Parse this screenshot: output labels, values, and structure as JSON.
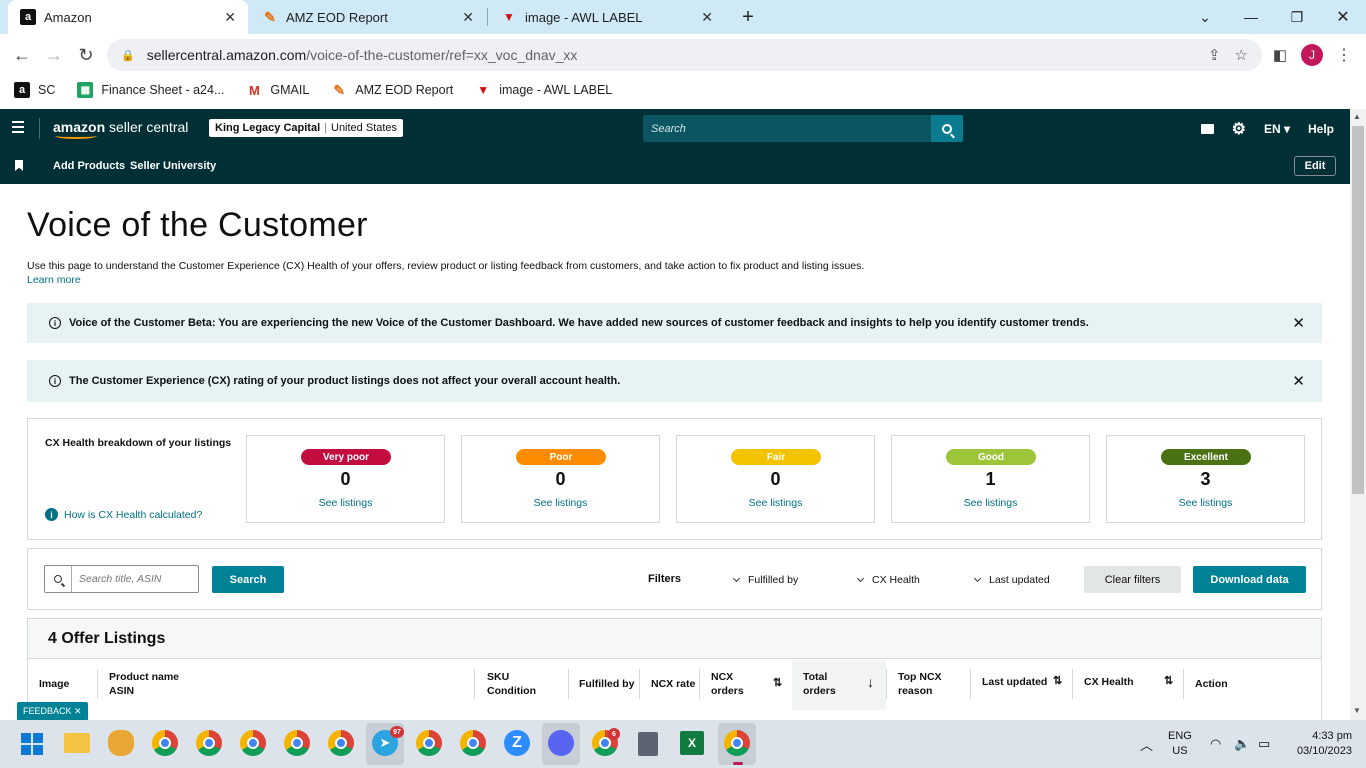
{
  "browser": {
    "tabs": [
      {
        "title": "Amazon",
        "active": true
      },
      {
        "title": "AMZ EOD Report",
        "active": false
      },
      {
        "title": "image - AWL LABEL",
        "active": false
      }
    ],
    "url_domain": "sellercentral.amazon.com",
    "url_path": "/voice-of-the-customer/ref=xx_voc_dnav_xx",
    "profile_initial": "J",
    "bookmarks": [
      {
        "label": "SC",
        "icon": "amazon-icon"
      },
      {
        "label": "Finance Sheet - a24...",
        "icon": "sheets-icon"
      },
      {
        "label": "GMAIL",
        "icon": "gmail-icon"
      },
      {
        "label": "AMZ EOD Report",
        "icon": "eod-icon"
      },
      {
        "label": "image - AWL LABEL",
        "icon": "awl-icon"
      }
    ]
  },
  "header": {
    "logo_bold": "amazon",
    "logo_rest": " seller central",
    "account_name": "King Legacy Capital",
    "account_region": "United States",
    "search_placeholder": "Search",
    "language": "EN",
    "help": "Help"
  },
  "subnav": {
    "links": [
      "Add Products",
      "Seller University"
    ],
    "edit": "Edit"
  },
  "page": {
    "title": "Voice of the Customer",
    "description": "Use this page to understand the Customer Experience (CX) Health of your offers, review product or listing feedback from customers, and take action to fix product and listing issues.",
    "learn_more": "Learn more",
    "banners": [
      "Voice of the Customer Beta: You are experiencing the new Voice of the Customer Dashboard. We have added new sources of customer feedback and insights to help you identify customer trends.",
      "The Customer Experience (CX) rating of your product listings does not affect your overall account health."
    ]
  },
  "cx_health": {
    "title": "CX Health breakdown of your listings",
    "how_link": "How is CX Health calculated?",
    "cards": [
      {
        "label": "Very poor",
        "count": "0",
        "link": "See listings",
        "color": "#c40d3f"
      },
      {
        "label": "Poor",
        "count": "0",
        "link": "See listings",
        "color": "#ff8c00"
      },
      {
        "label": "Fair",
        "count": "0",
        "link": "See listings",
        "color": "#f3c300"
      },
      {
        "label": "Good",
        "count": "1",
        "link": "See listings",
        "color": "#9dc53a"
      },
      {
        "label": "Excellent",
        "count": "3",
        "link": "See listings",
        "color": "#4b7212"
      }
    ]
  },
  "filters": {
    "search_placeholder": "Search title, ASIN",
    "search_button": "Search",
    "label": "Filters",
    "dropdowns": [
      "Fulfilled by",
      "CX Health",
      "Last updated"
    ],
    "clear": "Clear filters",
    "download": "Download data"
  },
  "listings": {
    "title": "4 Offer Listings",
    "columns": {
      "image": "Image",
      "product_name": "Product name",
      "asin": "ASIN",
      "sku": "SKU",
      "condition": "Condition",
      "fulfilled_by": "Fulfilled by",
      "ncx_rate": "NCX rate",
      "ncx_orders_1": "NCX",
      "ncx_orders_2": "orders",
      "total_orders_1": "Total",
      "total_orders_2": "orders",
      "top_ncx_1": "Top NCX",
      "top_ncx_2": "reason",
      "last_updated": "Last updated",
      "cx_health": "CX Health",
      "action": "Action"
    }
  },
  "feedback": "FEEDBACK",
  "taskbar": {
    "language": "ENG",
    "region": "US",
    "time": "4:33 pm",
    "date": "03/10/2023",
    "telegram_badge": "97",
    "chrome_badge": "6"
  }
}
